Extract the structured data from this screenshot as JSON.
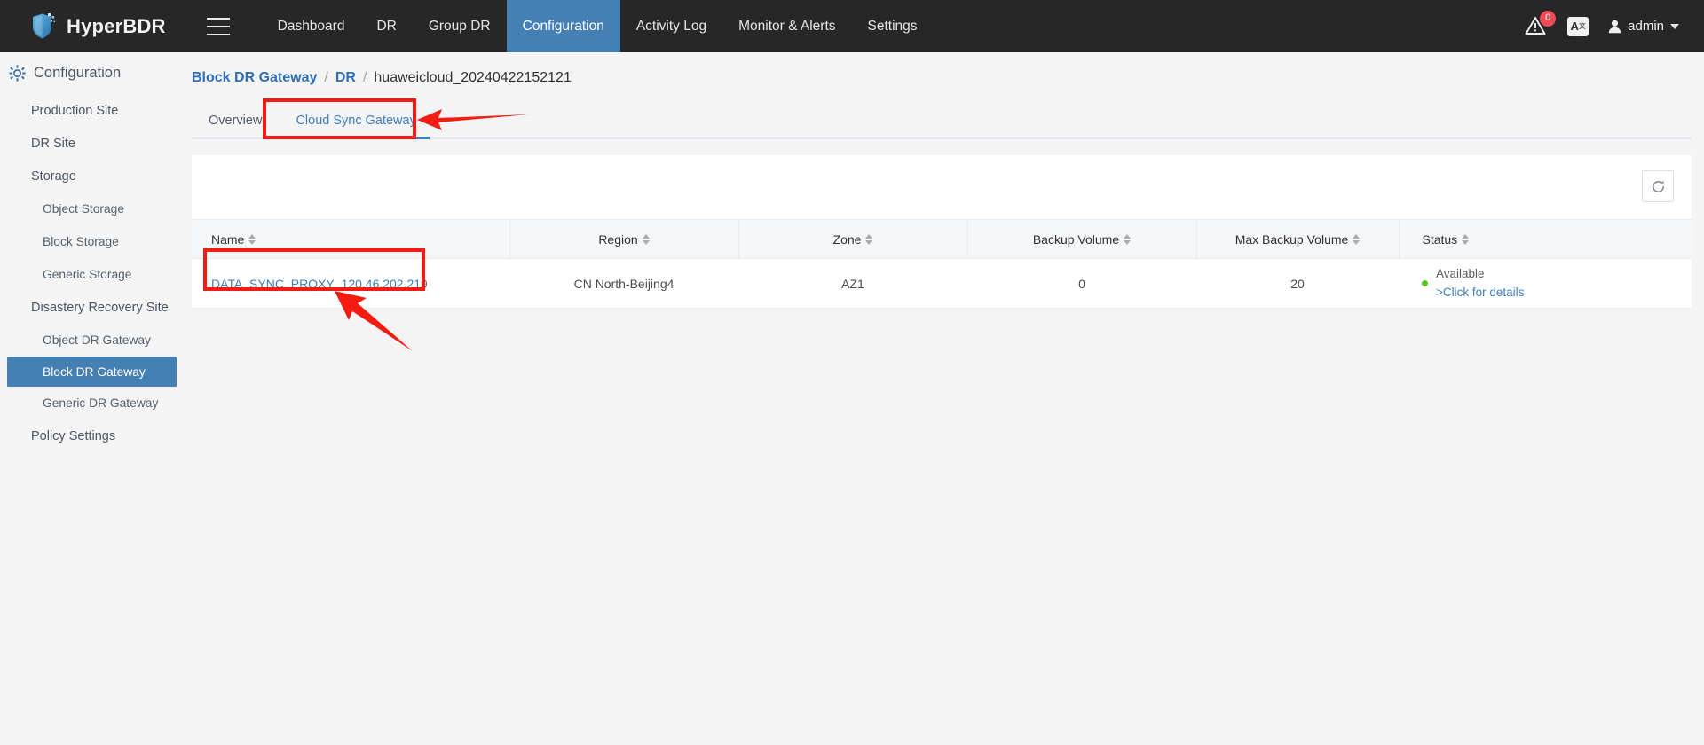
{
  "topbar": {
    "brand": "HyperBDR",
    "menu_icon": "hamburger-icon",
    "nav": [
      {
        "label": "Dashboard",
        "active": false
      },
      {
        "label": "DR",
        "active": false
      },
      {
        "label": "Group DR",
        "active": false
      },
      {
        "label": "Configuration",
        "active": true
      },
      {
        "label": "Activity Log",
        "active": false
      },
      {
        "label": "Monitor & Alerts",
        "active": false
      },
      {
        "label": "Settings",
        "active": false
      }
    ],
    "alert_badge": "0",
    "lang_label": "A",
    "lang_sup": "文",
    "user": "admin"
  },
  "sidebar": {
    "title": "Configuration",
    "items": [
      {
        "label": "Production Site",
        "level": 1,
        "active": false
      },
      {
        "label": "DR Site",
        "level": 1,
        "active": false
      },
      {
        "label": "Storage",
        "level": 1,
        "active": false
      },
      {
        "label": "Object Storage",
        "level": 2,
        "active": false
      },
      {
        "label": "Block Storage",
        "level": 2,
        "active": false
      },
      {
        "label": "Generic Storage",
        "level": 2,
        "active": false
      },
      {
        "label": "Disastery Recovery Site",
        "level": 1,
        "active": false
      },
      {
        "label": "Object DR Gateway",
        "level": 2,
        "active": false
      },
      {
        "label": "Block DR Gateway",
        "level": 2,
        "active": true
      },
      {
        "label": "Generic DR Gateway",
        "level": 2,
        "active": false
      },
      {
        "label": "Policy Settings",
        "level": 1,
        "active": false
      }
    ]
  },
  "breadcrumb": {
    "root": "Block DR Gateway",
    "sep": "/",
    "second": "DR",
    "current": "huaweicloud_20240422152121"
  },
  "tabs": [
    {
      "label": "Overview",
      "active": false
    },
    {
      "label": "Cloud Sync Gateway",
      "active": true
    }
  ],
  "toolbar": {
    "refresh_icon": "refresh-icon"
  },
  "table": {
    "columns": [
      {
        "label": "Name",
        "sortable": true
      },
      {
        "label": "Region",
        "sortable": true
      },
      {
        "label": "Zone",
        "sortable": true
      },
      {
        "label": "Backup Volume",
        "sortable": true
      },
      {
        "label": "Max Backup Volume",
        "sortable": true
      },
      {
        "label": "Status",
        "sortable": true
      }
    ],
    "rows": [
      {
        "name": "DATA_SYNC_PROXY_120.46.202.219",
        "region": "CN North-Beijing4",
        "zone": "AZ1",
        "backup_volume": "0",
        "max_backup_volume": "20",
        "status_text": "Available",
        "status_details": ">Click for details",
        "status_color": "#58c321"
      }
    ]
  },
  "annotations": {
    "color": "#f41c12",
    "highlight_tab": "Cloud Sync Gateway",
    "highlight_row_name": "DATA_SYNC_PROXY_120.46.202.219"
  }
}
